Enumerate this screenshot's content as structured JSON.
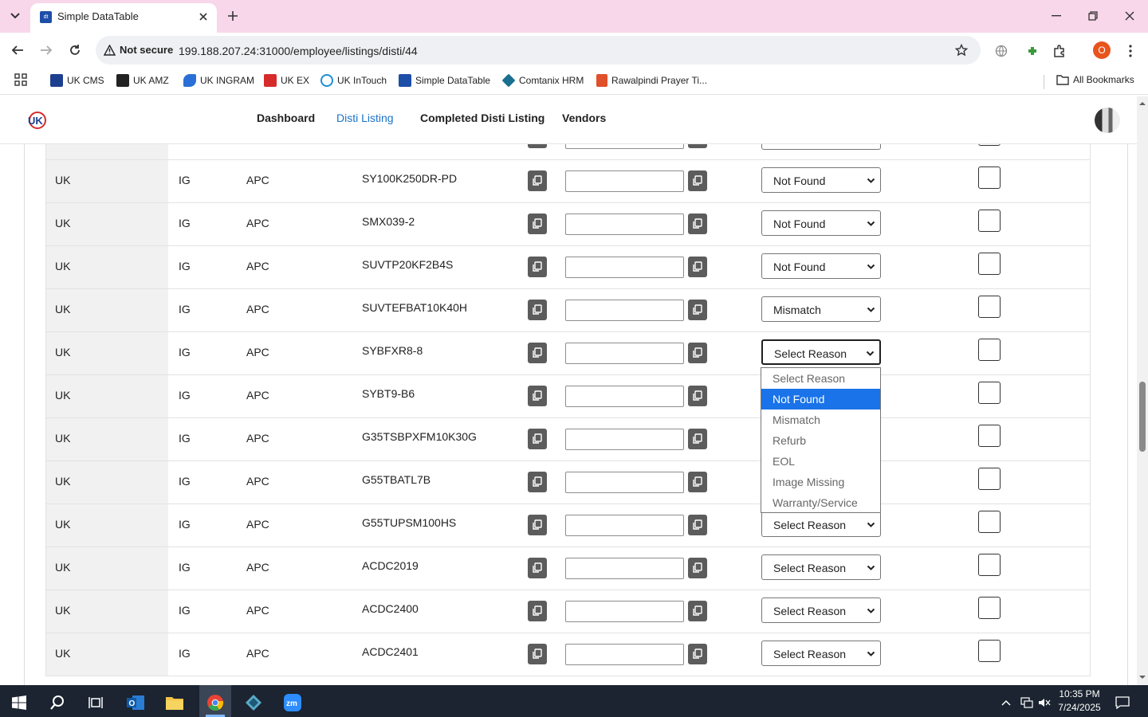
{
  "browser": {
    "tab_title": "Simple DataTable",
    "favicon_text": "dt",
    "security_label": "Not secure",
    "url": "199.188.207.24:31000/employee/listings/disti/44",
    "profile_initial": "O"
  },
  "bookmarks": [
    {
      "label": "UK CMS",
      "color": "#1d3f8f"
    },
    {
      "label": "UK AMZ",
      "color": "#222222"
    },
    {
      "label": "UK INGRAM",
      "color": "#2a6fd6"
    },
    {
      "label": "UK EX",
      "color": "#d62b2b"
    },
    {
      "label": "UK InTouch",
      "color": "#1a8fd6"
    },
    {
      "label": "Simple DataTable",
      "color": "#1d4ea8"
    },
    {
      "label": "Comtanix HRM",
      "color": "#1b6f8f"
    },
    {
      "label": "Rawalpindi Prayer Ti...",
      "color": "#e0502a"
    }
  ],
  "all_bookmarks": "All Bookmarks",
  "nav": {
    "links": [
      "Dashboard",
      "Disti Listing",
      "Completed Disti Listing",
      "Vendors"
    ],
    "active": "Disti Listing"
  },
  "rows": [
    {
      "region": "UK",
      "distributor": "IG",
      "brand": "APC",
      "sku": "SY100K250DR-PD",
      "reason": "Not Found"
    },
    {
      "region": "UK",
      "distributor": "IG",
      "brand": "APC",
      "sku": "SMX039-2",
      "reason": "Not Found"
    },
    {
      "region": "UK",
      "distributor": "IG",
      "brand": "APC",
      "sku": "SUVTP20KF2B4S",
      "reason": "Not Found"
    },
    {
      "region": "UK",
      "distributor": "IG",
      "brand": "APC",
      "sku": "SUVTEFBAT10K40H",
      "reason": "Mismatch"
    },
    {
      "region": "UK",
      "distributor": "IG",
      "brand": "APC",
      "sku": "SYBFXR8-8",
      "reason": "Select Reason"
    },
    {
      "region": "UK",
      "distributor": "IG",
      "brand": "APC",
      "sku": "SYBT9-B6",
      "reason": "Select Reason"
    },
    {
      "region": "UK",
      "distributor": "IG",
      "brand": "APC",
      "sku": "G35TSBPXFM10K30G",
      "reason": "Select Reason"
    },
    {
      "region": "UK",
      "distributor": "IG",
      "brand": "APC",
      "sku": "G55TBATL7B",
      "reason": "Select Reason"
    },
    {
      "region": "UK",
      "distributor": "IG",
      "brand": "APC",
      "sku": "G55TUPSM100HS",
      "reason": "Select Reason"
    },
    {
      "region": "UK",
      "distributor": "IG",
      "brand": "APC",
      "sku": "ACDC2019",
      "reason": "Select Reason"
    },
    {
      "region": "UK",
      "distributor": "IG",
      "brand": "APC",
      "sku": "ACDC2400",
      "reason": "Select Reason"
    },
    {
      "region": "UK",
      "distributor": "IG",
      "brand": "APC",
      "sku": "ACDC2401",
      "reason": "Select Reason"
    }
  ],
  "reason_options": [
    "Select Reason",
    "Not Found",
    "Mismatch",
    "Refurb",
    "EOL",
    "Image Missing",
    "Warranty/Service"
  ],
  "dropdown": {
    "highlighted": "Not Found"
  },
  "taskbar": {
    "time": "10:35 PM",
    "date": "7/24/2025"
  },
  "colors": {
    "accent": "#1a73e8",
    "nav_active": "#1a73c9",
    "tabbar": "#f8d7ea"
  }
}
